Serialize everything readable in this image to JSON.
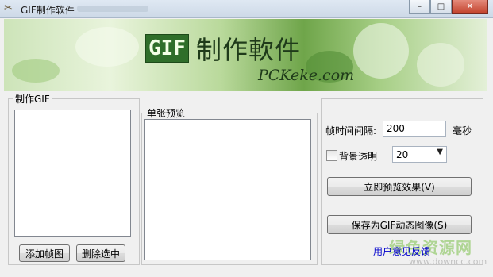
{
  "window": {
    "title": "GIF制作软件",
    "minimize": "–",
    "maximize": "□",
    "close": "✕"
  },
  "banner": {
    "logo_gif": "GIF",
    "logo_text": "制作軟件",
    "site": "PCKeke.com"
  },
  "make_group": {
    "label": "制作GIF",
    "add_frame": "添加帧图",
    "delete_selected": "删除选中"
  },
  "preview_group": {
    "label": "单张预览"
  },
  "settings": {
    "interval_label": "帧时间间隔:",
    "interval_value": "200",
    "interval_unit": "毫秒",
    "transparent_label": "背景透明",
    "transparent_checked": false,
    "transparent_select_value": "20",
    "preview_button": "立即预览效果(V)",
    "save_button": "保存为GIF动态图像(S)",
    "feedback_link": "用户意见反馈"
  },
  "watermark": {
    "site_name": "绿色资源网",
    "url": "www.downcc.com"
  },
  "colors": {
    "link": "#0000cc",
    "banner_green": "#6fa54a",
    "logo_dark": "#1f3b1a"
  }
}
